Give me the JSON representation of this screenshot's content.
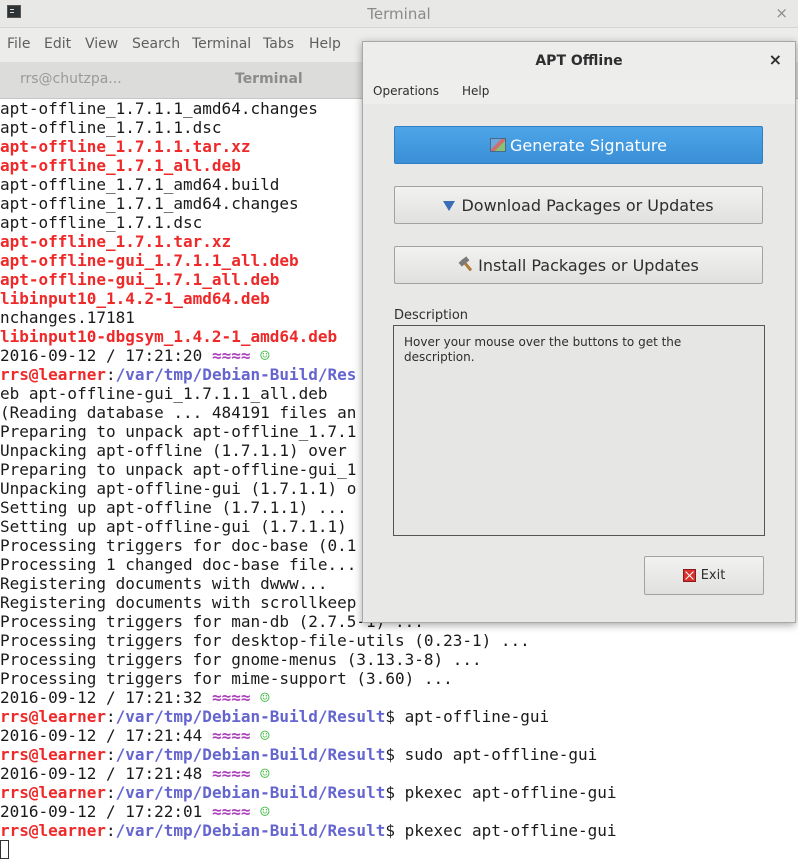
{
  "terminal": {
    "window_title": "Terminal",
    "close_glyph": "×",
    "menu": [
      "File",
      "Edit",
      "View",
      "Search",
      "Terminal",
      "Tabs",
      "Help"
    ],
    "tabs": [
      "rrs@chutzpa...",
      "Terminal"
    ],
    "lines": [
      "apt-offline_1.7.1.1_amd64.changes",
      "apt-offline_1.7.1.1.dsc",
      "apt-offline_1.7.1.1.tar.xz",
      "apt-offline_1.7.1_all.deb",
      "apt-offline_1.7.1_amd64.build",
      "apt-offline_1.7.1_amd64.changes",
      "apt-offline_1.7.1.dsc",
      "apt-offline_1.7.1.tar.xz",
      "apt-offline-gui_1.7.1.1_all.deb",
      "apt-offline-gui_1.7.1_all.deb",
      "libinput10_1.4.2-1_amd64.deb",
      "nchanges.17181",
      "libinput10-dbgsym_1.4.2-1_amd64.deb",
      "2016-09-12 / 17:21:20",
      "/var/tmp/Debian-Build/Res",
      "eb apt-offline-gui_1.7.1.1_all.deb",
      "(Reading database ... 484191 files an",
      "Preparing to unpack apt-offline_1.7.1",
      "Unpacking apt-offline (1.7.1.1) over",
      "Preparing to unpack apt-offline-gui_1",
      "Unpacking apt-offline-gui (1.7.1.1) o",
      "Setting up apt-offline (1.7.1.1) ...",
      "Setting up apt-offline-gui (1.7.1.1)",
      "Processing triggers for doc-base (0.1",
      "Processing 1 changed doc-base file...",
      "Registering documents with dwww...",
      "Registering documents with scrollkeep",
      "Processing triggers for man-db (2.7.5-1) ...",
      "Processing triggers for desktop-file-utils (0.23-1) ...",
      "Processing triggers for gnome-menus (3.13.3-8) ...",
      "Processing triggers for mime-support (3.60) ...",
      "2016-09-12 / 17:21:32",
      "/var/tmp/Debian-Build/Result",
      "2016-09-12 / 17:21:44",
      "/var/tmp/Debian-Build/Result",
      "2016-09-12 / 17:21:48",
      "/var/tmp/Debian-Build/Result",
      "2016-09-12 / 17:22:01",
      "/var/tmp/Debian-Build/Result"
    ],
    "user_host": "rrs@learner",
    "colon": ":",
    "prompt_symbol": "$",
    "wave": "≈≈≈≈",
    "smiley": "☺",
    "commands": [
      "apt-offline-gui",
      "sudo apt-offline-gui",
      "pkexec apt-offline-gui",
      "pkexec apt-offline-gui"
    ]
  },
  "apt_offline": {
    "title": "APT Offline",
    "close_glyph": "×",
    "menu": [
      "Operations",
      "Help"
    ],
    "buttons": {
      "generate": "Generate Signature",
      "download": "Download Packages or Updates",
      "install": "Install Packages or Updates",
      "exit": "Exit"
    },
    "description_label": "Description",
    "description_text": "Hover your mouse over the buttons to get the description."
  },
  "colors": {
    "accent_blue": "#3a8fd6",
    "terminal_red": "#ef2929",
    "terminal_path": "#6565d0",
    "terminal_magenta": "#ad3fbd",
    "terminal_green": "#3fb93f"
  }
}
